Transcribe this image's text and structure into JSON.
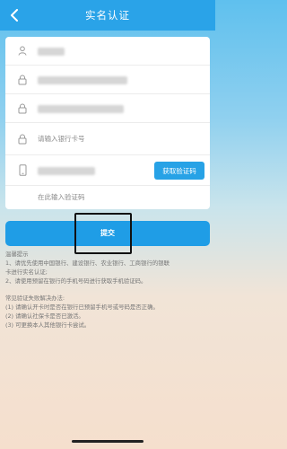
{
  "nav": {
    "title": "实名认证",
    "back_icon": "chevron-left-icon"
  },
  "form": {
    "rows": [
      {
        "icon": "user-icon"
      },
      {
        "icon": "lock-icon"
      },
      {
        "icon": "lock-icon"
      },
      {
        "icon": "lock-icon",
        "placeholder": "请输入银行卡号"
      },
      {
        "icon": "phone-icon",
        "button_label": "获取验证码"
      },
      {
        "placeholder": "在此输入验证码"
      }
    ]
  },
  "submit_label": "提交",
  "tips": {
    "title": "温馨提示",
    "lines": [
      "1、请优先使用中国银行、建设银行、农业银行、工商银行的银联",
      "卡进行实名认证;",
      "2、请使用预留在银行的手机号码进行获取手机验证码。"
    ],
    "failure_title": "常见验证失败解决办法:",
    "failure_lines": [
      "(1) 请确认开卡时是否在银行已预留手机号或号码是否正确。",
      "(2) 请确认社保卡是否已激活。",
      "(3) 可更换本人其他银行卡尝试。"
    ]
  },
  "colors": {
    "nav": "#2aa3e8",
    "accent": "#27a2e6",
    "submit": "#1f9de6"
  }
}
